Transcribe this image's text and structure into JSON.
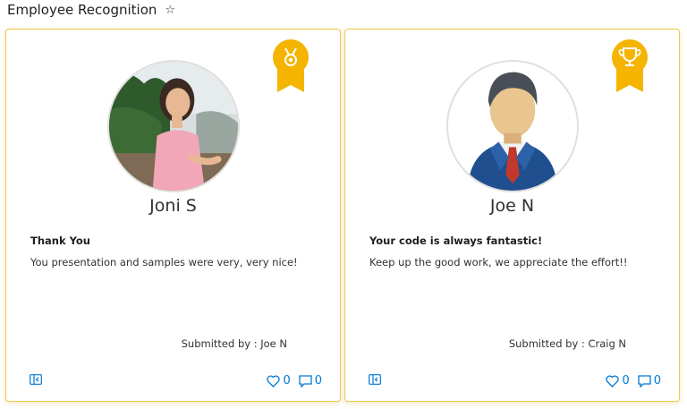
{
  "page": {
    "title": "Employee Recognition",
    "favorite_icon": "star-outline-icon"
  },
  "colors": {
    "card_border": "#f3c94a",
    "badge": "#f4b400",
    "action_blue": "#0078d4"
  },
  "cards": [
    {
      "name": "Joni S",
      "badge_icon": "medal-icon",
      "message_title": "Thank You",
      "message_body": "You presentation and samples were very, very nice!",
      "submitted": "Submitted by : Joe N",
      "likes": "0",
      "comments": "0"
    },
    {
      "name": "Joe N",
      "badge_icon": "trophy-icon",
      "message_title": "Your code is always fantastic!",
      "message_body": "Keep up the good work, we appreciate the effort!!",
      "submitted": "Submitted by : Craig N",
      "likes": "0",
      "comments": "0"
    }
  ]
}
